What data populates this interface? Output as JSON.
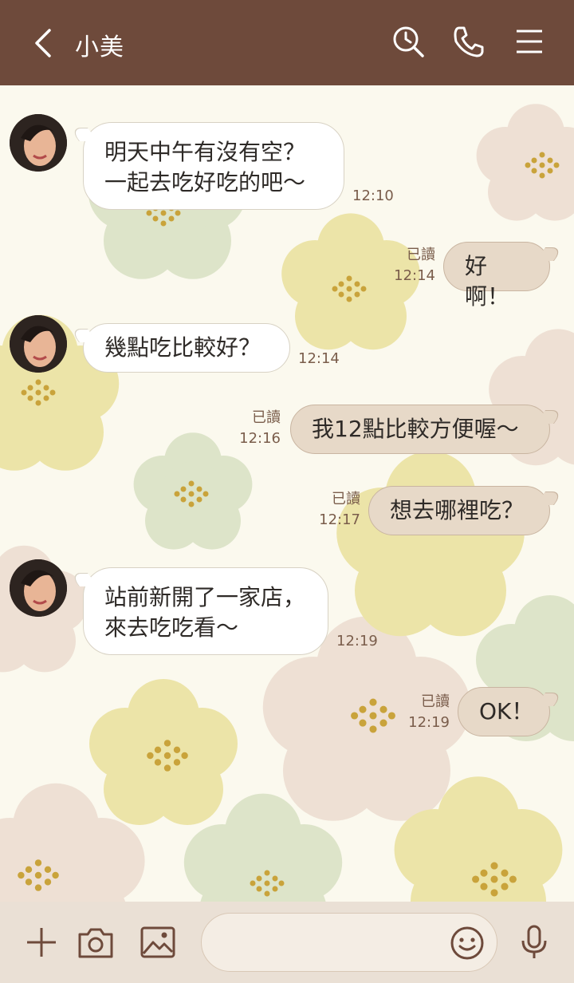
{
  "header": {
    "title": "小美"
  },
  "colors": {
    "header_bg": "#6e4a3b",
    "incoming_bubble": "#ffffff",
    "outgoing_bubble": "#e7d9c8",
    "footer_bg": "#eae0d5",
    "background": "#fbf9ee"
  },
  "messages": [
    {
      "direction": "incoming",
      "text": "明天中午有沒有空？\n一起去吃好吃的吧～",
      "time": "12:10"
    },
    {
      "direction": "outgoing",
      "text": "好啊！",
      "read": "已讀",
      "time": "12:14"
    },
    {
      "direction": "incoming",
      "text": "幾點吃比較好？",
      "time": "12:14"
    },
    {
      "direction": "outgoing",
      "text": "我12點比較方便喔～",
      "read": "已讀",
      "time": "12:16"
    },
    {
      "direction": "outgoing",
      "text": "想去哪裡吃？",
      "read": "已讀",
      "time": "12:17"
    },
    {
      "direction": "incoming",
      "text": "站前新開了一家店，\n來去吃吃看～",
      "time": "12:19"
    },
    {
      "direction": "outgoing",
      "text": "OK！",
      "read": "已讀",
      "time": "12:19"
    }
  ],
  "composer": {
    "placeholder": ""
  },
  "icons": {
    "back": "chevron-left-icon",
    "search": "search-history-icon",
    "call": "phone-icon",
    "menu": "hamburger-menu-icon",
    "add": "plus-icon",
    "camera": "camera-icon",
    "gallery": "image-icon",
    "emoji": "smiley-icon",
    "voice": "microphone-icon"
  }
}
